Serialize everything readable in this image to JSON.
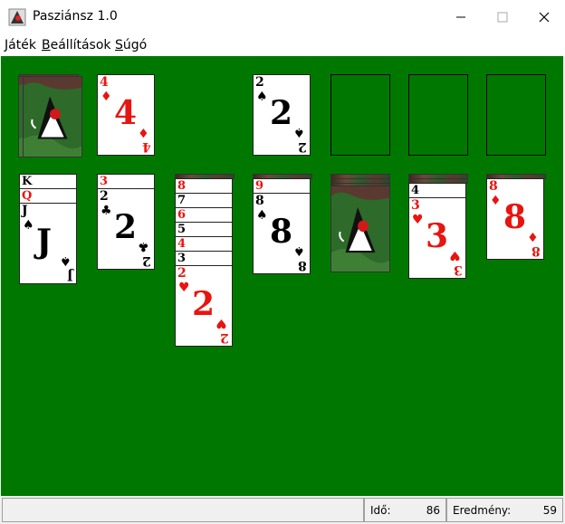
{
  "window": {
    "title": "Pasziánsz 1.0"
  },
  "menu": [
    {
      "label": "Játék",
      "underline": "J"
    },
    {
      "label": "Beállítások",
      "underline": "B"
    },
    {
      "label": "Súgó",
      "underline": "S"
    }
  ],
  "waste": {
    "rank": "4",
    "suit": "♦",
    "color": "red"
  },
  "foundations": [
    {
      "rank": "2",
      "suit": "♠",
      "color": "black"
    },
    null,
    null,
    null
  ],
  "tableau": [
    {
      "strips": [
        {
          "rank": "K",
          "color": "black"
        },
        {
          "rank": "Q",
          "color": "red"
        }
      ],
      "top": {
        "rank": "J",
        "suit": "♠",
        "color": "black"
      }
    },
    {
      "strips": [
        {
          "rank": "3",
          "color": "red"
        }
      ],
      "top": {
        "rank": "2",
        "suit": "♣",
        "color": "black"
      }
    },
    {
      "strips": [
        {
          "rank": "8",
          "color": "red"
        },
        {
          "rank": "7",
          "color": "black"
        },
        {
          "rank": "6",
          "color": "red"
        },
        {
          "rank": "5",
          "color": "black"
        },
        {
          "rank": "4",
          "color": "red"
        },
        {
          "rank": "3",
          "color": "black"
        }
      ],
      "top": {
        "rank": "2",
        "suit": "♥",
        "color": "red"
      }
    },
    {
      "strips": [
        {
          "rank": "9",
          "color": "red"
        }
      ],
      "top": {
        "rank": "8",
        "suit": "♠",
        "color": "black"
      }
    },
    {
      "strips": [],
      "top": null
    },
    {
      "strips": [
        {
          "rank": "4",
          "color": "black"
        }
      ],
      "top": {
        "rank": "3",
        "suit": "♥",
        "color": "red"
      }
    },
    {
      "strips": [],
      "top": {
        "rank": "8",
        "suit": "♦",
        "color": "red"
      }
    }
  ],
  "status": {
    "time_label": "Idő:",
    "time_value": "86",
    "score_label": "Eredmény:",
    "score_value": "59"
  },
  "colors": {
    "table": "#007800",
    "red": "#e8140f",
    "black": "#000000"
  }
}
